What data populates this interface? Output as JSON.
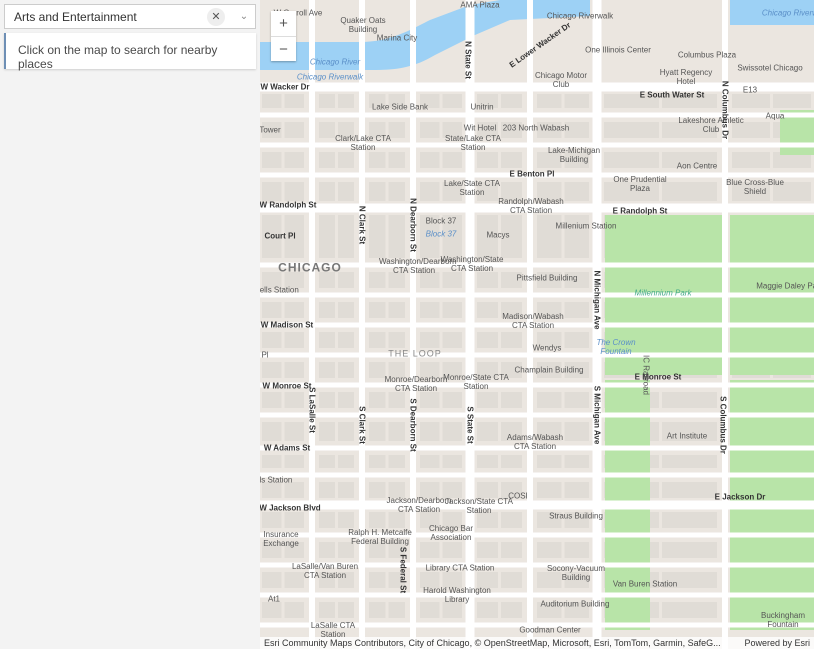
{
  "search": {
    "value": "Arts and Entertainment",
    "clear_icon": "close-icon",
    "dropdown_icon": "chevron-down-icon"
  },
  "hint": "Click on the map to search for nearby places",
  "zoom": {
    "in": "+",
    "out": "−"
  },
  "attribution": {
    "sources": "Esri Community Maps Contributors, City of Chicago, © OpenStreetMap, Microsoft, Esri, TomTom, Garmin, SafeG...",
    "powered": "Powered by Esri"
  },
  "colors": {
    "water": "#9dd1f5",
    "park": "#b8e4a8",
    "road": "#ffffff",
    "block": "#e0dcd6"
  },
  "labels": [
    "W Carroll Ave",
    "Quaker Oats Building",
    "Marina City",
    "AMA Plaza",
    "Chicago Riverwalk",
    "Chicago Riverwalk",
    "E Lower Wacker Dr",
    "One Illinois Center",
    "Columbus Plaza",
    "Swissotel Chicago",
    "Chicago River",
    "Chicago Riverwalk",
    "W Wacker Dr",
    "Chicago Motor Club",
    "Hyatt Regency Hotel",
    "E South Water St",
    "E13",
    "Lake Side Bank",
    "Unitrin",
    "Wit Hotel",
    "203 North Wabash",
    "Aqua",
    "Lakeshore Athletic Club",
    "Clark/Lake CTA Station",
    "State/Lake CTA Station",
    "Lake-Michigan Building",
    "Aon Centre",
    "E Benton Pl",
    "One Prudential Plaza",
    "Blue Cross-Blue Shield",
    "Lake/State CTA Station",
    "Randolph/Wabash CTA Station",
    "W Randolph St",
    "E Randolph St",
    "Millenium Station",
    "Block 37",
    "Block 37",
    "Macys",
    "Washington/Dearborn CTA Station",
    "Washington/State CTA Station",
    "CHICAGO",
    "Pittsfield Building",
    "Millennium Park",
    "Maggie Daley Park",
    "W Madison St",
    "Madison/Wabash CTA Station",
    "THE LOOP",
    "Wendys",
    "The Crown Fountain",
    "Champlain Building",
    "E Monroe St",
    "W Monroe St",
    "Monroe/Dearborn CTA Station",
    "Monroe/State CTA Station",
    "Art Institute",
    "W Adams St",
    "Adams/Wabash CTA Station",
    "COSI",
    "E Jackson Dr",
    "W Jackson Blvd",
    "Jackson/Dearborn CTA Station",
    "Jackson/State CTA Station",
    "Straus Building",
    "Ralph H. Metcalfe Federal Building",
    "Chicago Bar Association",
    "Insurance Exchange",
    "LaSalle/Van Buren CTA Station",
    "Library CTA Station",
    "Socony-Vacuum Building",
    "Van Buren Station",
    "Harold Washington Library",
    "Auditorium Building",
    "Buckingham Fountain",
    "LaSalle CTA Station",
    "Goodman Center",
    "N State St",
    "N Clark St",
    "N Dearborn St",
    "S LaSalle St",
    "S Clark St",
    "S Dearborn St",
    "S State St",
    "S Michigan Ave",
    "N Michigan Ave",
    "N Columbus Dr",
    "S Columbus Dr",
    "S Federal St",
    "Court Pl",
    "Tower",
    "on/Wells Station",
    "Pl",
    "/Wells Station",
    "At1",
    "IC Railroad"
  ]
}
